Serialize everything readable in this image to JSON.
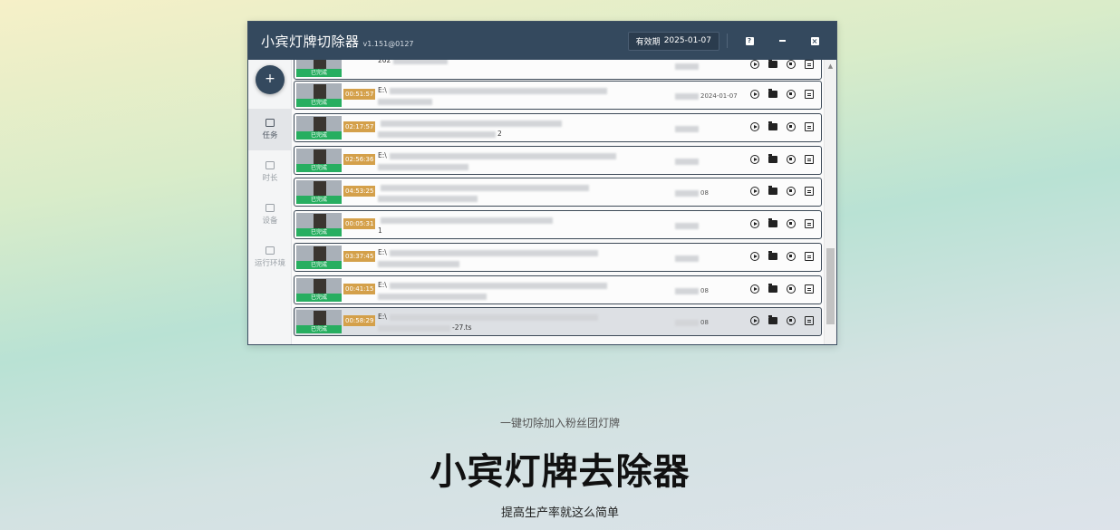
{
  "window": {
    "title": "小宾灯牌切除器",
    "version": "v1.151@0127",
    "validity_label": "有效期",
    "validity_date": "2025-01-07",
    "help_label": "?",
    "minimize_label": "–",
    "close_label": "×"
  },
  "sidebar": {
    "add_label": "+",
    "items": [
      {
        "label": "任务",
        "icon": "task-list-icon",
        "active": true
      },
      {
        "label": "时长",
        "icon": "duration-icon",
        "active": false
      },
      {
        "label": "设备",
        "icon": "device-icon",
        "active": false
      },
      {
        "label": "运行环境",
        "icon": "environment-icon",
        "active": false
      }
    ]
  },
  "tasks": [
    {
      "status": "已完成",
      "duration": "",
      "line1": "202",
      "line2": "",
      "date": "",
      "partial": true
    },
    {
      "status": "已完成",
      "duration": "00:51:57",
      "line1": "E:\\",
      "line2": "",
      "date": "2024-01-07"
    },
    {
      "status": "已完成",
      "duration": "02:17:57",
      "line1": "",
      "line2": "2",
      "date": ""
    },
    {
      "status": "已完成",
      "duration": "02:56:36",
      "line1": "E:\\",
      "line2": "",
      "date": ""
    },
    {
      "status": "已完成",
      "duration": "04:53:25",
      "line1": "",
      "line2": "",
      "date": "08"
    },
    {
      "status": "已完成",
      "duration": "00:05:31",
      "line1": "",
      "line2": "1",
      "date": ""
    },
    {
      "status": "已完成",
      "duration": "03:37:45",
      "line1": "E:\\",
      "line2": "",
      "date": ""
    },
    {
      "status": "已完成",
      "duration": "00:41:15",
      "line1": "E:\\",
      "line2": "",
      "date": "08"
    },
    {
      "status": "已完成",
      "duration": "00:58:29",
      "line1": "E:\\",
      "line2": "-27.ts",
      "date": "08"
    }
  ],
  "landing": {
    "tagline": "一键切除加入粉丝团灯牌",
    "title": "小宾灯牌去除器",
    "subtitle": "提高生产率就这么简单"
  },
  "colors": {
    "titlebar": "#34495e",
    "status_done": "#27ae60",
    "duration_tag": "#d4a04a"
  }
}
